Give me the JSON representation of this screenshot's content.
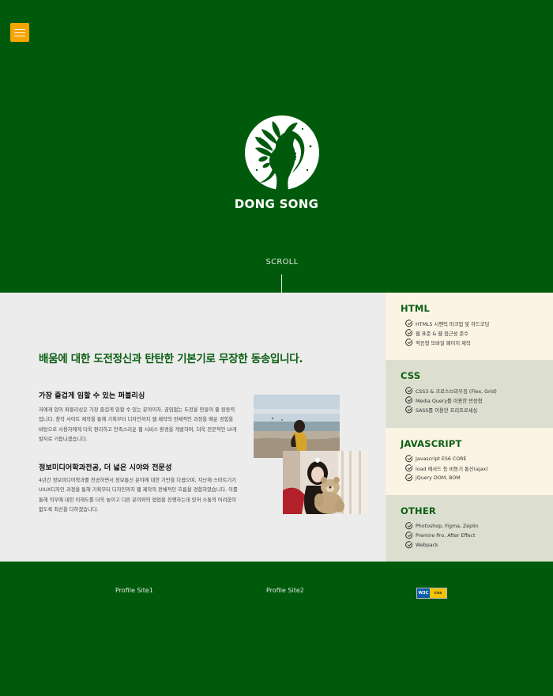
{
  "hero": {
    "brand": "DONG SONG",
    "scroll": "SCROLL"
  },
  "menu": {
    "icon": "hamburger-menu-icon",
    "accent": "#f6a400"
  },
  "colors": {
    "primary": "#005a0c",
    "heading": "#0b5e12",
    "cream": "#fbf4e4",
    "sage": "#dcdfd0"
  },
  "about": {
    "headline": "배움에 대한 도전정신과 탄탄한 기본기로 무장한 동송입니다.",
    "block1": {
      "title": "가장 즐겁게 임할 수 있는 퍼블리싱",
      "text": "저에게 있어 퍼블리싱은 가장 즐겁게 임할 수 있는 분야이자, 끊임없는 도전을 만들어 줄 원동력입니다. 창작 사이트 제작을 통해 기획부터 디자인까지 웹 제작의 전체적인 과정을 배운 경험을 바탕으로 사용자에게 더욱 편리하고 만족스러운 웹 서비스 환경을 개발하며, 더욱 전문적인 UI개발자로 거듭나겠습니다."
    },
    "block2": {
      "title": "정보미디어학과전공, 더 넓은 시야와 전문성",
      "text": "4년간 정보미디어학과를 전공하면서 정보통신 분야에 대한 기반을 다졌으며, 지난해 스마트기기 UIUX디자인 과정을 통해 기획부터 디자인까지 웹 제작의 전체적인 흐름을 경험하였습니다. 이를 통해 직무에 대한 이해도를 더욱 높이고 다른 분야와의 협업을 진행하는데 있어 소통의 어려움이 없도록 최선을 다하겠습니다."
    }
  },
  "skills": [
    {
      "title": "HTML",
      "items": [
        "HTML5 시맨틱 마크업 및 하드코딩",
        "웹 표준 & 웹 접근성 준수",
        "적응형 모바일 페이지 제작"
      ]
    },
    {
      "title": "CSS",
      "items": [
        "CSS3 & 크로스브라우징 (Flex, Grid)",
        "Media Query를 이용한 반응형",
        "SASS를 이용한 프리프로세싱"
      ]
    },
    {
      "title": "JAVASCRIPT",
      "items": [
        "Javascript ES6 CORE",
        "load 메서드 등 비동기 통신(ajax)",
        "jQuery DOM, BOM"
      ]
    },
    {
      "title": "OTHER",
      "items": [
        "Photoshop, Figma, Zeplin",
        "Premire Pro, After Effect",
        "Webpack"
      ]
    }
  ],
  "footer": {
    "link1": "Profile Site1",
    "link2": "Profile Site2",
    "badge": {
      "w3c": "W3C",
      "css": "css",
      "icon": "w3c-css-validator-badge"
    }
  }
}
